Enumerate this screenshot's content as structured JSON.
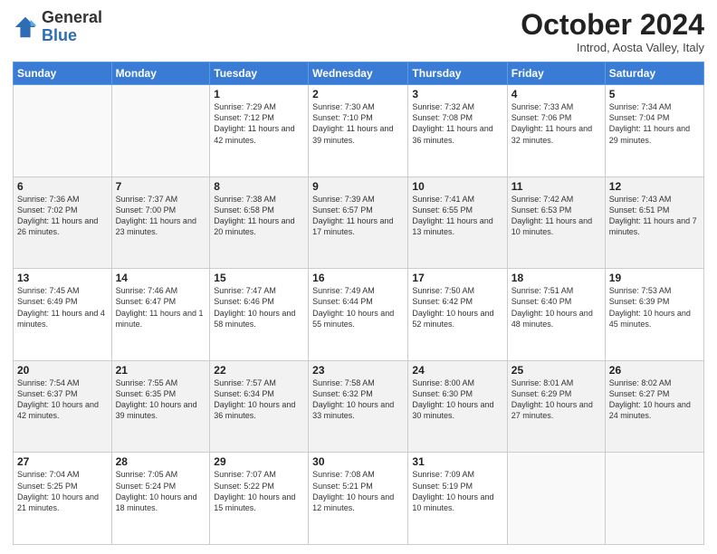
{
  "header": {
    "logo_general": "General",
    "logo_blue": "Blue",
    "month": "October 2024",
    "location": "Introd, Aosta Valley, Italy"
  },
  "weekdays": [
    "Sunday",
    "Monday",
    "Tuesday",
    "Wednesday",
    "Thursday",
    "Friday",
    "Saturday"
  ],
  "weeks": [
    [
      {
        "day": "",
        "info": ""
      },
      {
        "day": "",
        "info": ""
      },
      {
        "day": "1",
        "info": "Sunrise: 7:29 AM\nSunset: 7:12 PM\nDaylight: 11 hours and 42 minutes."
      },
      {
        "day": "2",
        "info": "Sunrise: 7:30 AM\nSunset: 7:10 PM\nDaylight: 11 hours and 39 minutes."
      },
      {
        "day": "3",
        "info": "Sunrise: 7:32 AM\nSunset: 7:08 PM\nDaylight: 11 hours and 36 minutes."
      },
      {
        "day": "4",
        "info": "Sunrise: 7:33 AM\nSunset: 7:06 PM\nDaylight: 11 hours and 32 minutes."
      },
      {
        "day": "5",
        "info": "Sunrise: 7:34 AM\nSunset: 7:04 PM\nDaylight: 11 hours and 29 minutes."
      }
    ],
    [
      {
        "day": "6",
        "info": "Sunrise: 7:36 AM\nSunset: 7:02 PM\nDaylight: 11 hours and 26 minutes."
      },
      {
        "day": "7",
        "info": "Sunrise: 7:37 AM\nSunset: 7:00 PM\nDaylight: 11 hours and 23 minutes."
      },
      {
        "day": "8",
        "info": "Sunrise: 7:38 AM\nSunset: 6:58 PM\nDaylight: 11 hours and 20 minutes."
      },
      {
        "day": "9",
        "info": "Sunrise: 7:39 AM\nSunset: 6:57 PM\nDaylight: 11 hours and 17 minutes."
      },
      {
        "day": "10",
        "info": "Sunrise: 7:41 AM\nSunset: 6:55 PM\nDaylight: 11 hours and 13 minutes."
      },
      {
        "day": "11",
        "info": "Sunrise: 7:42 AM\nSunset: 6:53 PM\nDaylight: 11 hours and 10 minutes."
      },
      {
        "day": "12",
        "info": "Sunrise: 7:43 AM\nSunset: 6:51 PM\nDaylight: 11 hours and 7 minutes."
      }
    ],
    [
      {
        "day": "13",
        "info": "Sunrise: 7:45 AM\nSunset: 6:49 PM\nDaylight: 11 hours and 4 minutes."
      },
      {
        "day": "14",
        "info": "Sunrise: 7:46 AM\nSunset: 6:47 PM\nDaylight: 11 hours and 1 minute."
      },
      {
        "day": "15",
        "info": "Sunrise: 7:47 AM\nSunset: 6:46 PM\nDaylight: 10 hours and 58 minutes."
      },
      {
        "day": "16",
        "info": "Sunrise: 7:49 AM\nSunset: 6:44 PM\nDaylight: 10 hours and 55 minutes."
      },
      {
        "day": "17",
        "info": "Sunrise: 7:50 AM\nSunset: 6:42 PM\nDaylight: 10 hours and 52 minutes."
      },
      {
        "day": "18",
        "info": "Sunrise: 7:51 AM\nSunset: 6:40 PM\nDaylight: 10 hours and 48 minutes."
      },
      {
        "day": "19",
        "info": "Sunrise: 7:53 AM\nSunset: 6:39 PM\nDaylight: 10 hours and 45 minutes."
      }
    ],
    [
      {
        "day": "20",
        "info": "Sunrise: 7:54 AM\nSunset: 6:37 PM\nDaylight: 10 hours and 42 minutes."
      },
      {
        "day": "21",
        "info": "Sunrise: 7:55 AM\nSunset: 6:35 PM\nDaylight: 10 hours and 39 minutes."
      },
      {
        "day": "22",
        "info": "Sunrise: 7:57 AM\nSunset: 6:34 PM\nDaylight: 10 hours and 36 minutes."
      },
      {
        "day": "23",
        "info": "Sunrise: 7:58 AM\nSunset: 6:32 PM\nDaylight: 10 hours and 33 minutes."
      },
      {
        "day": "24",
        "info": "Sunrise: 8:00 AM\nSunset: 6:30 PM\nDaylight: 10 hours and 30 minutes."
      },
      {
        "day": "25",
        "info": "Sunrise: 8:01 AM\nSunset: 6:29 PM\nDaylight: 10 hours and 27 minutes."
      },
      {
        "day": "26",
        "info": "Sunrise: 8:02 AM\nSunset: 6:27 PM\nDaylight: 10 hours and 24 minutes."
      }
    ],
    [
      {
        "day": "27",
        "info": "Sunrise: 7:04 AM\nSunset: 5:25 PM\nDaylight: 10 hours and 21 minutes."
      },
      {
        "day": "28",
        "info": "Sunrise: 7:05 AM\nSunset: 5:24 PM\nDaylight: 10 hours and 18 minutes."
      },
      {
        "day": "29",
        "info": "Sunrise: 7:07 AM\nSunset: 5:22 PM\nDaylight: 10 hours and 15 minutes."
      },
      {
        "day": "30",
        "info": "Sunrise: 7:08 AM\nSunset: 5:21 PM\nDaylight: 10 hours and 12 minutes."
      },
      {
        "day": "31",
        "info": "Sunrise: 7:09 AM\nSunset: 5:19 PM\nDaylight: 10 hours and 10 minutes."
      },
      {
        "day": "",
        "info": ""
      },
      {
        "day": "",
        "info": ""
      }
    ]
  ]
}
